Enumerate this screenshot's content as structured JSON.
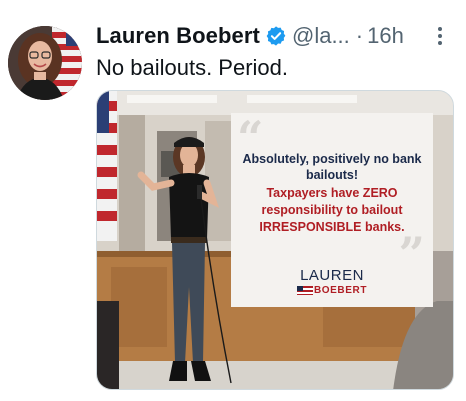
{
  "tweet": {
    "display_name": "Lauren Boebert",
    "verified_icon": "verified-badge-icon",
    "handle": "@la...",
    "separator": "·",
    "time": "16h",
    "more_icon": "more-options-icon",
    "text": "No bailouts. Period."
  },
  "media": {
    "quote_line1": "Absolutely, positively no bank bailouts!",
    "quote_line2": "Taxpayers have ZERO responsibility to bailout IRRESPONSIBLE banks.",
    "brand_first": "LAUREN",
    "brand_last": "BOEBERT"
  },
  "colors": {
    "verified": "#1d9bf0",
    "brand_navy": "#1b2a4a",
    "brand_red": "#b01e24",
    "secondary_text": "#536471"
  }
}
